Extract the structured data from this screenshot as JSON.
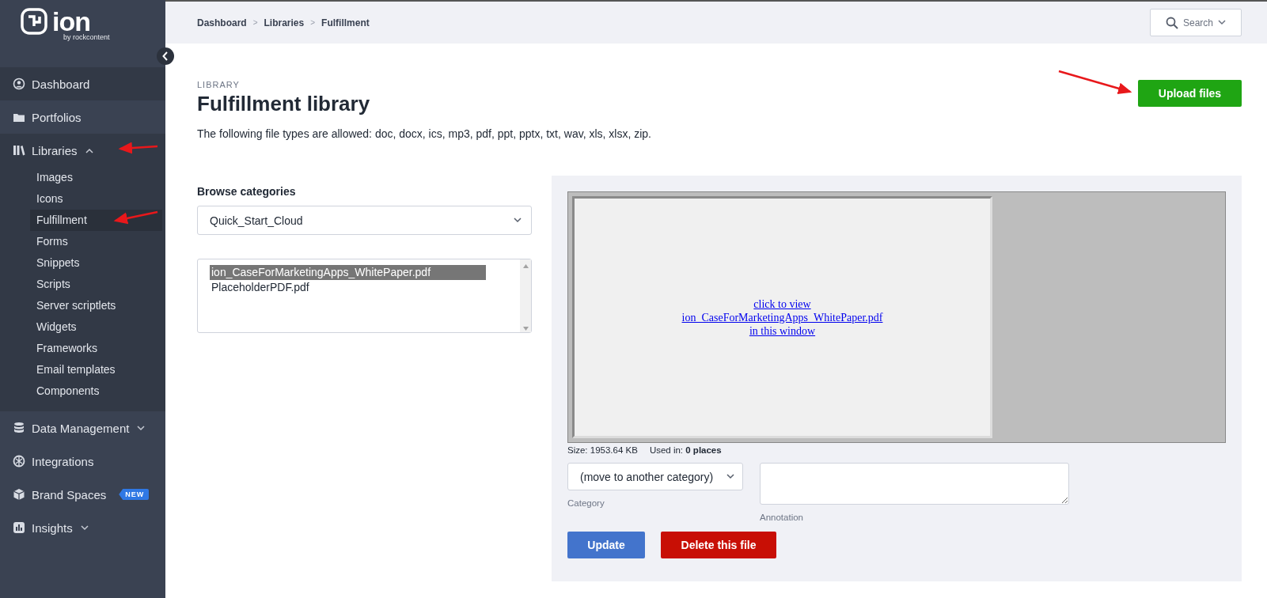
{
  "logo": {
    "name": "ion",
    "tagline": "by rockcontent"
  },
  "sidebar": {
    "items": [
      {
        "label": "Dashboard",
        "kind": "link"
      },
      {
        "label": "Portfolios",
        "kind": "link"
      },
      {
        "label": "Libraries",
        "kind": "group",
        "expanded": true,
        "children": [
          {
            "label": "Images",
            "selected": false
          },
          {
            "label": "Icons",
            "selected": false
          },
          {
            "label": "Fulfillment",
            "selected": true
          },
          {
            "label": "Forms",
            "selected": false
          },
          {
            "label": "Snippets",
            "selected": false
          },
          {
            "label": "Scripts",
            "selected": false
          },
          {
            "label": "Server scriptlets",
            "selected": false
          },
          {
            "label": "Widgets",
            "selected": false
          },
          {
            "label": "Frameworks",
            "selected": false
          },
          {
            "label": "Email templates",
            "selected": false
          },
          {
            "label": "Components",
            "selected": false
          }
        ]
      },
      {
        "label": "Data Management",
        "kind": "group",
        "expanded": false
      },
      {
        "label": "Integrations",
        "kind": "link"
      },
      {
        "label": "Brand Spaces",
        "kind": "link",
        "badge": "NEW"
      },
      {
        "label": "Insights",
        "kind": "group",
        "expanded": false
      }
    ]
  },
  "breadcrumbs": {
    "separator": ">",
    "items": [
      "Dashboard",
      "Libraries",
      "Fulfillment"
    ]
  },
  "search": {
    "label": "Search"
  },
  "page": {
    "eyebrow": "LIBRARY",
    "title": "Fulfillment library",
    "description": "The following file types are allowed: doc, docx, ics, mp3, pdf, ppt, pptx, txt, wav, xls, xlsx, zip.",
    "upload_button": "Upload files"
  },
  "browse": {
    "label": "Browse categories",
    "category": "Quick_Start_Cloud",
    "files": [
      {
        "name": "ion_CaseForMarketingApps_WhitePaper.pdf",
        "selected": true
      },
      {
        "name": "PlaceholderPDF.pdf",
        "selected": false
      }
    ]
  },
  "preview": {
    "link_lines": [
      "click to view",
      "ion_CaseForMarketingApps_WhitePaper.pdf",
      "in this window"
    ],
    "size": "Size: 1953.64 KB",
    "used_in": "Used in: **0 places**",
    "category_select": "(move to another category)",
    "category_label": "Category",
    "annotation_label": "Annotation",
    "update_button": "Update",
    "delete_button": "Delete this file"
  }
}
